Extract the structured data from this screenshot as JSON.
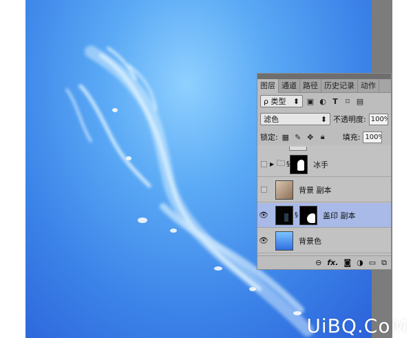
{
  "watermark": "UiBQ.CoM",
  "panel": {
    "tabs": [
      "图层",
      "通道",
      "路径",
      "历史记录",
      "动作"
    ],
    "filter": {
      "kind_label": "ρ 类型",
      "icons": [
        "image-filter-icon",
        "adjustment-filter-icon",
        "type-filter-icon",
        "shape-filter-icon",
        "smart-filter-icon"
      ]
    },
    "blend_mode": "滤色",
    "opacity_label": "不透明度:",
    "opacity_value": "100%",
    "lock_label": "锁定:",
    "fill_label": "填充:",
    "fill_value": "100%",
    "layers": [
      {
        "name": "冰手",
        "visible": false,
        "type": "group"
      },
      {
        "name": "背景 副本",
        "visible": false,
        "type": "image"
      },
      {
        "name": "盖印 副本",
        "visible": true,
        "type": "masked",
        "selected": true
      },
      {
        "name": "背景色",
        "visible": true,
        "type": "fill"
      }
    ],
    "bottom_icons": [
      "link-icon",
      "fx-icon",
      "mask-icon",
      "adjustment-icon",
      "folder-icon",
      "new-layer-icon"
    ],
    "fx_label": "fx."
  },
  "colors": {
    "canvas_light": "#8fd0ff",
    "canvas_dark": "#2a5fd8",
    "selected_row": "#a9b9e8"
  }
}
